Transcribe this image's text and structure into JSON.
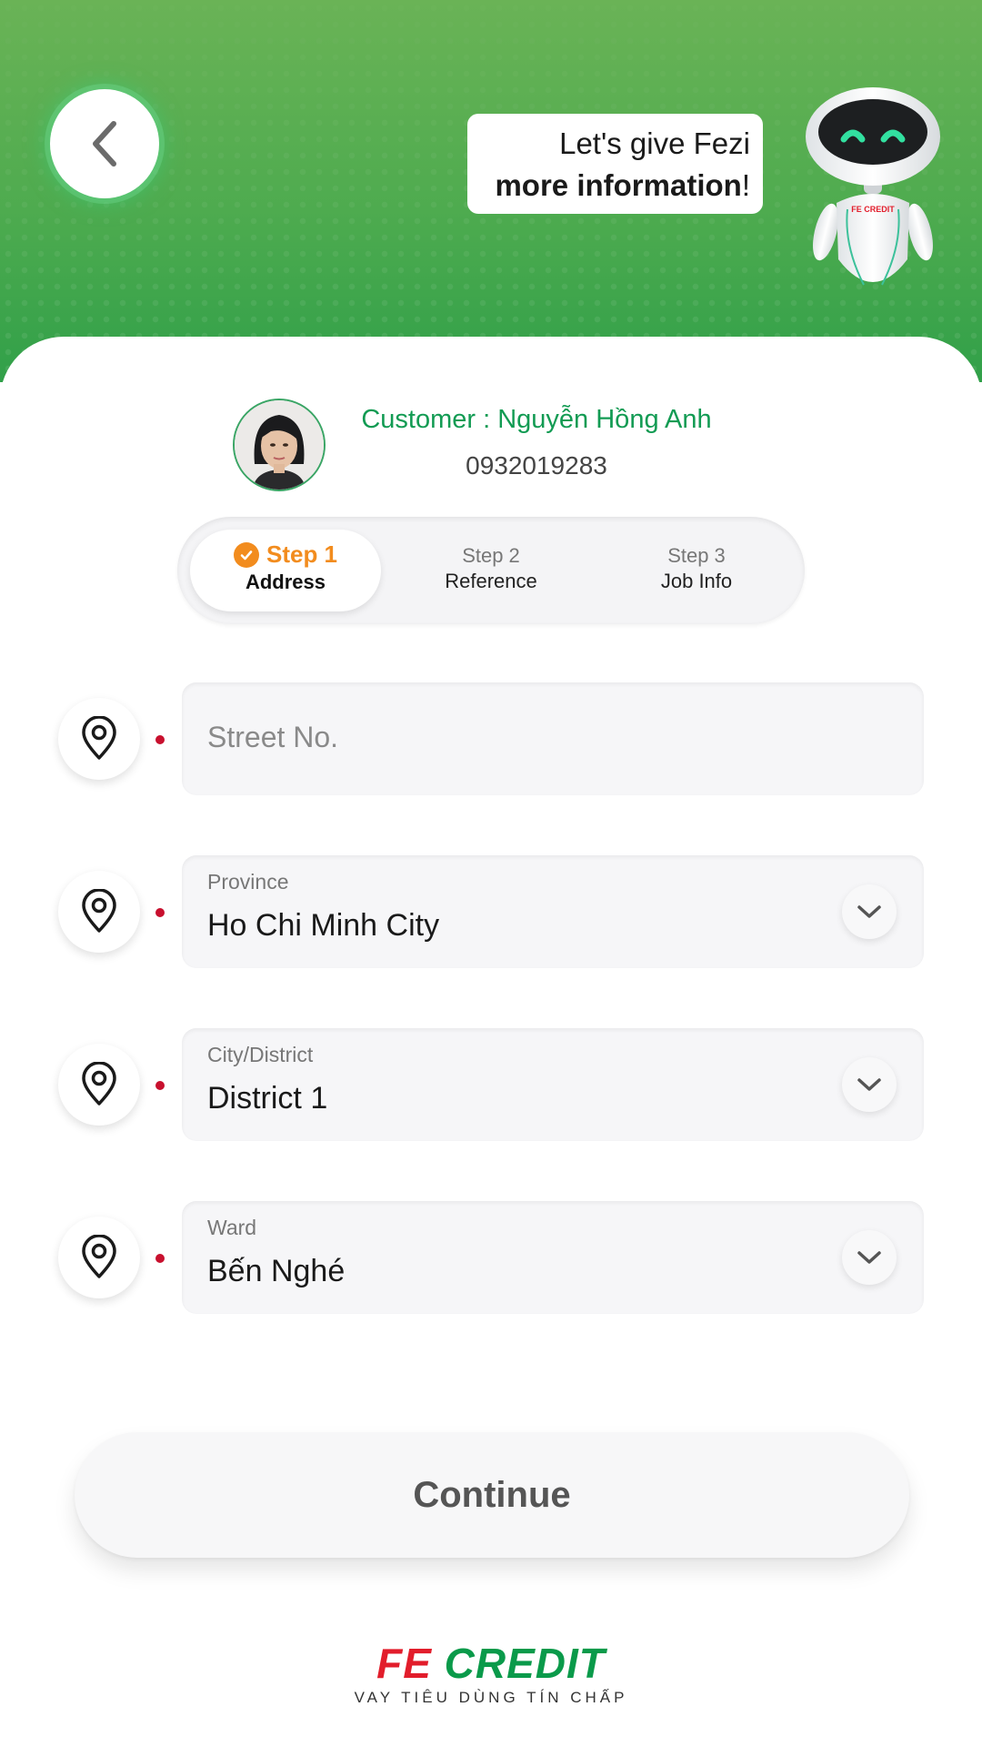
{
  "header": {
    "bubble_line1": "Let's give Fezi",
    "bubble_line2_bold": "more information",
    "bubble_line2_end": "!",
    "robot_badge": "FE CREDIT"
  },
  "customer": {
    "name": "Customer : Nguyễn Hồng Anh",
    "phone": "0932019283"
  },
  "steps": [
    {
      "num": "Step 1",
      "title": "Address",
      "state": "active"
    },
    {
      "num": "Step 2",
      "title": "Reference",
      "state": "pending"
    },
    {
      "num": "Step 3",
      "title": "Job Info",
      "state": "pending"
    }
  ],
  "form": {
    "street": {
      "placeholder": "Street No.",
      "value": ""
    },
    "province": {
      "label": "Province",
      "value": "Ho Chi Minh City"
    },
    "district": {
      "label": "City/District",
      "value": "District 1"
    },
    "ward": {
      "label": "Ward",
      "value": "Bến Nghé"
    }
  },
  "continue_label": "Continue",
  "brand": {
    "fe": "FE",
    "credit": "CREDIT",
    "tagline": "VAY TIÊU DÙNG TÍN CHẤP",
    "colors": {
      "red": "#e21d2b",
      "green": "#0a9a4a",
      "accent": "#f28c1e"
    }
  }
}
